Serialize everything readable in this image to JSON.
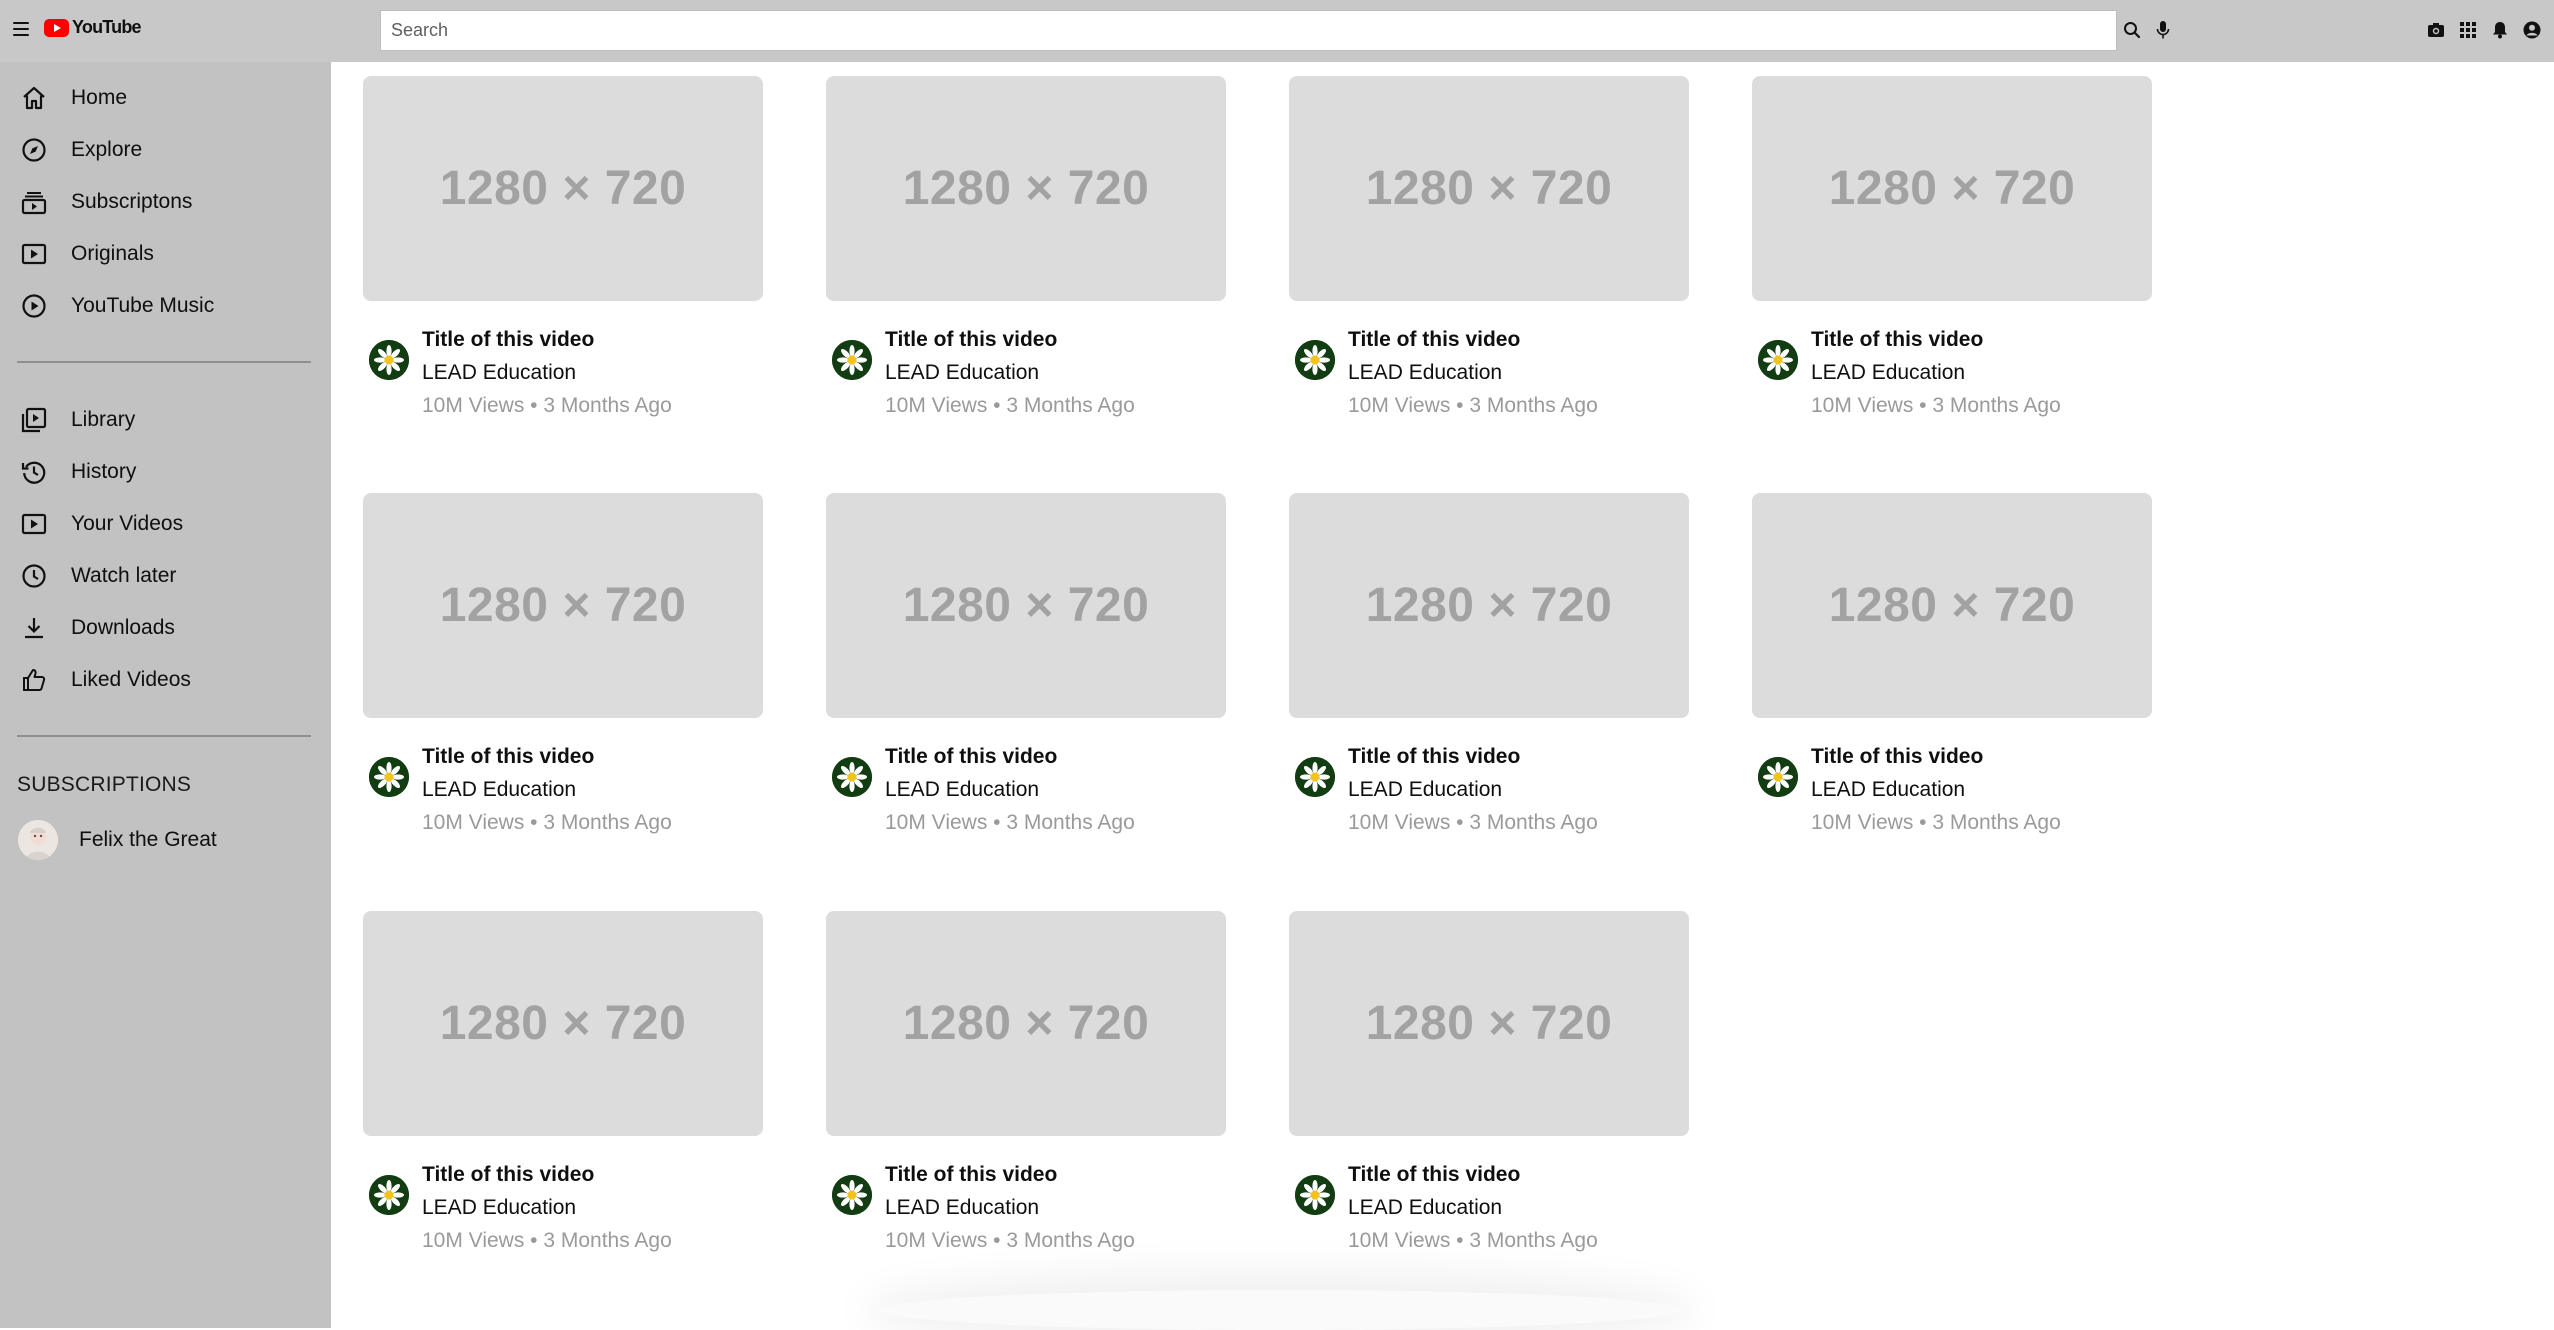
{
  "header": {
    "logo_text": "YouTube",
    "search_placeholder": "Search"
  },
  "sidebar": {
    "main_items": [
      {
        "label": "Home",
        "icon": "home-icon"
      },
      {
        "label": "Explore",
        "icon": "compass-icon"
      },
      {
        "label": "Subscriptons",
        "icon": "subscriptions-icon"
      },
      {
        "label": "Originals",
        "icon": "originals-icon"
      },
      {
        "label": "YouTube Music",
        "icon": "music-icon"
      }
    ],
    "library_items": [
      {
        "label": "Library",
        "icon": "library-icon"
      },
      {
        "label": "History",
        "icon": "history-icon"
      },
      {
        "label": "Your Videos",
        "icon": "your-videos-icon"
      },
      {
        "label": "Watch later",
        "icon": "clock-icon"
      },
      {
        "label": "Downloads",
        "icon": "download-icon"
      },
      {
        "label": "Liked Videos",
        "icon": "thumbs-up-icon"
      }
    ],
    "subscriptions_heading": "SUBSCRIPTIONS",
    "subscriptions": [
      {
        "name": "Felix the Great"
      }
    ]
  },
  "videos": [
    {
      "thumb": "1280 × 720",
      "title": "Title of this video",
      "channel": "LEAD Education",
      "meta": "10M Views • 3 Months Ago"
    },
    {
      "thumb": "1280 × 720",
      "title": "Title of this video",
      "channel": "LEAD Education",
      "meta": "10M Views • 3 Months Ago"
    },
    {
      "thumb": "1280 × 720",
      "title": "Title of this video",
      "channel": "LEAD Education",
      "meta": "10M Views • 3 Months Ago"
    },
    {
      "thumb": "1280 × 720",
      "title": "Title of this video",
      "channel": "LEAD Education",
      "meta": "10M Views • 3 Months Ago"
    },
    {
      "thumb": "1280 × 720",
      "title": "Title of this video",
      "channel": "LEAD Education",
      "meta": "10M Views • 3 Months Ago"
    },
    {
      "thumb": "1280 × 720",
      "title": "Title of this video",
      "channel": "LEAD Education",
      "meta": "10M Views • 3 Months Ago"
    },
    {
      "thumb": "1280 × 720",
      "title": "Title of this video",
      "channel": "LEAD Education",
      "meta": "10M Views • 3 Months Ago"
    },
    {
      "thumb": "1280 × 720",
      "title": "Title of this video",
      "channel": "LEAD Education",
      "meta": "10M Views • 3 Months Ago"
    },
    {
      "thumb": "1280 × 720",
      "title": "Title of this video",
      "channel": "LEAD Education",
      "meta": "10M Views • 3 Months Ago"
    },
    {
      "thumb": "1280 × 720",
      "title": "Title of this video",
      "channel": "LEAD Education",
      "meta": "10M Views • 3 Months Ago"
    },
    {
      "thumb": "1280 × 720",
      "title": "Title of this video",
      "channel": "LEAD Education",
      "meta": "10M Views • 3 Months Ago"
    }
  ],
  "colors": {
    "topbar": "#c8c8c8",
    "sidebar": "#c2c2c2",
    "thumbnail": "#dcdcdc",
    "logo_red": "#ff0000"
  }
}
